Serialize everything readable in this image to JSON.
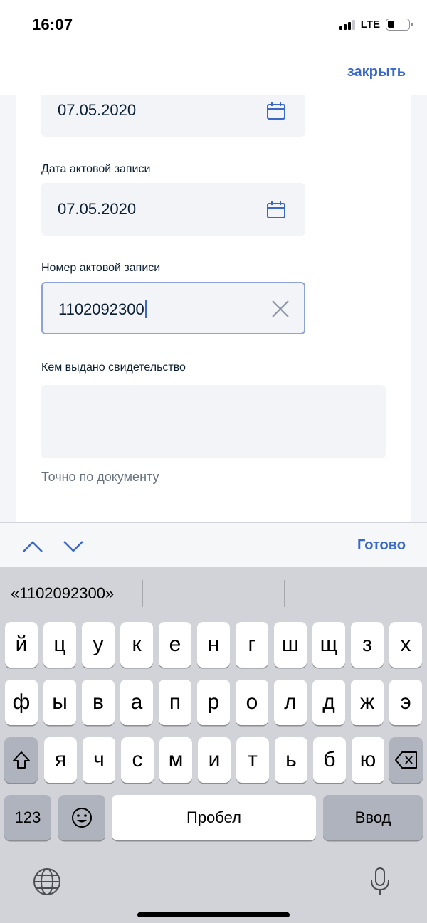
{
  "status_bar": {
    "time": "16:07",
    "network": "LTE"
  },
  "nav": {
    "close_label": "закрыть"
  },
  "form": {
    "date_top_value": "07.05.2020",
    "act_date_label": "Дата актовой записи",
    "act_date_value": "07.05.2020",
    "act_number_label": "Номер актовой записи",
    "act_number_value": "1102092300",
    "issuer_label": "Кем выдано свидетельство",
    "issuer_value": "",
    "issuer_hint": "Точно по документу"
  },
  "accessory": {
    "done_label": "Готово"
  },
  "keyboard": {
    "suggestion": "«1102092300»",
    "row1": [
      "й",
      "ц",
      "у",
      "к",
      "е",
      "н",
      "г",
      "ш",
      "щ",
      "з",
      "х"
    ],
    "row2": [
      "ф",
      "ы",
      "в",
      "а",
      "п",
      "р",
      "о",
      "л",
      "д",
      "ж",
      "э"
    ],
    "row3": [
      "я",
      "ч",
      "с",
      "м",
      "и",
      "т",
      "ь",
      "б",
      "ю"
    ],
    "numbers_label": "123",
    "space_label": "Пробел",
    "return_label": "Ввод"
  },
  "colors": {
    "accent": "#3a68c8",
    "field_bg": "#f2f4f8",
    "text": "#0b1f33",
    "hint": "#66727f"
  }
}
